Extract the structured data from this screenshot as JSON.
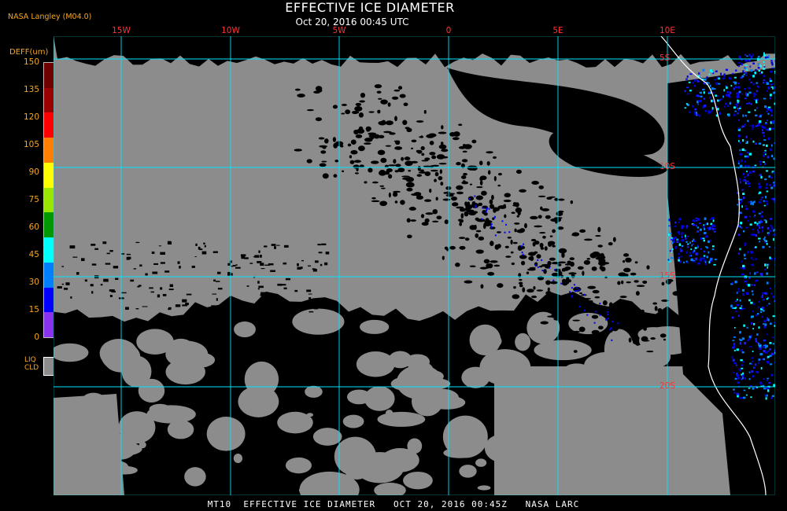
{
  "header": {
    "credit": "NASA Langley (M04.0)",
    "title": "EFFECTIVE ICE DIAMETER",
    "subtitle": "Oct 20, 2016 00:45 UTC"
  },
  "legend": {
    "label": "DEFF(um)",
    "ticks": [
      "150",
      "135",
      "120",
      "105",
      "90",
      "75",
      "60",
      "45",
      "30",
      "15",
      "0"
    ],
    "colors": [
      "#6e0000",
      "#990000",
      "#ff0000",
      "#ff8000",
      "#ffff00",
      "#99e600",
      "#009900",
      "#00ffff",
      "#0080ff",
      "#0000ff",
      "#8833ee"
    ],
    "liq_label_line1": "LIQ",
    "liq_label_line2": "CLD",
    "liq_color": "#8c8c8c"
  },
  "map": {
    "longitude_labels": [
      "15W",
      "10W",
      "5W",
      "0",
      "5E",
      "10E"
    ],
    "latitude_labels": [
      "5S",
      "10S",
      "15S",
      "20S"
    ],
    "grid_color": "#00e5ff",
    "label_color": "#ff3333",
    "background_color": "#8c8c8c",
    "clear_color": "#000000"
  },
  "footer": {
    "text": "MT10  EFFECTIVE ICE DIAMETER   OCT 20, 2016 00:45Z   NASA LARC"
  }
}
